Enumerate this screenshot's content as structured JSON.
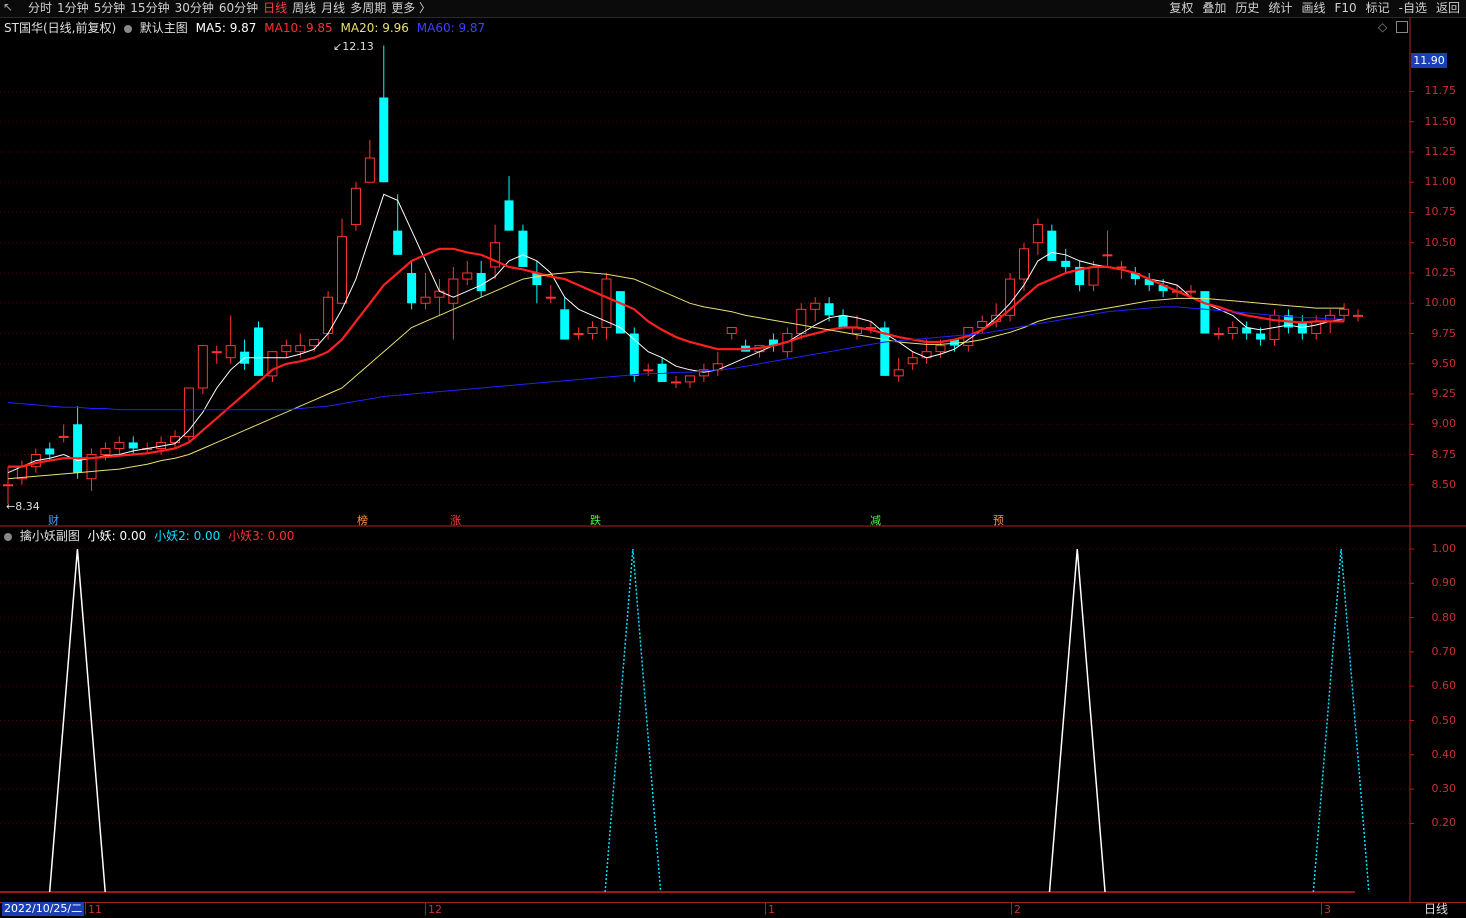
{
  "toolbar": {
    "periods": [
      "分时",
      "1分钟",
      "5分钟",
      "15分钟",
      "30分钟",
      "60分钟",
      "日线",
      "周线",
      "月线",
      "多周期",
      "更多 〉"
    ],
    "active_period": "日线",
    "right_buttons": [
      "复权",
      "叠加",
      "历史",
      "统计",
      "画线",
      "F10",
      "标记",
      "-自选",
      "返回"
    ]
  },
  "main_legend": {
    "title": "ST国华(日线,前复权)",
    "template": "默认主图",
    "ma5": "MA5: 9.87",
    "ma10": "MA10: 9.85",
    "ma20": "MA20: 9.96",
    "ma60": "MA60: 9.87"
  },
  "colors": {
    "up": "#ff3333",
    "down": "#00ffff",
    "ma5": "#ffffff",
    "ma10": "#ff2020",
    "ma20": "#e8e070",
    "ma60": "#2020ff",
    "grid": "#5a0000",
    "axis": "#b02020"
  },
  "price_axis": {
    "current_price_tag": "11.90",
    "labels": [
      "11.75",
      "11.50",
      "11.25",
      "11.00",
      "10.75",
      "10.50",
      "10.25",
      "10.00",
      "9.75",
      "9.50",
      "9.25",
      "9.00",
      "8.75",
      "8.50"
    ]
  },
  "annotations": {
    "high": "12.13",
    "low": "8.34",
    "markers": [
      {
        "text": "财",
        "color": "#4aa0ff"
      },
      {
        "text": "榜",
        "color": "#ff9040"
      },
      {
        "text": "涨",
        "color": "#ff4040"
      },
      {
        "text": "跌",
        "color": "#40ff40"
      },
      {
        "text": "减",
        "color": "#40ff40"
      },
      {
        "text": "预",
        "color": "#ff9040"
      }
    ]
  },
  "indicator_legend": {
    "title": "擒小妖副图",
    "s1": "小妖: 0.00",
    "s2": "小妖2: 0.00",
    "s3": "小妖3: 0.00"
  },
  "indicator_axis": {
    "labels": [
      "1.00",
      "0.90",
      "0.80",
      "0.70",
      "0.60",
      "0.50",
      "0.40",
      "0.30",
      "0.20"
    ]
  },
  "date_axis": {
    "first_date": "2022/10/25/二",
    "labels": [
      "11",
      "12",
      "1",
      "2",
      "3"
    ],
    "period_label": "日线"
  },
  "chart_data": [
    {
      "type": "candlestick",
      "title": "ST国华(日线,前复权)",
      "candles": [
        [
          8.5,
          8.65,
          8.34,
          8.5
        ],
        [
          8.55,
          8.7,
          8.5,
          8.65
        ],
        [
          8.65,
          8.8,
          8.6,
          8.75
        ],
        [
          8.8,
          8.85,
          8.7,
          8.75
        ],
        [
          8.9,
          9.0,
          8.85,
          8.9
        ],
        [
          9.0,
          9.15,
          8.55,
          8.6
        ],
        [
          8.55,
          8.8,
          8.45,
          8.75
        ],
        [
          8.75,
          8.85,
          8.7,
          8.8
        ],
        [
          8.8,
          8.9,
          8.75,
          8.85
        ],
        [
          8.85,
          8.9,
          8.75,
          8.8
        ],
        [
          8.8,
          8.85,
          8.75,
          8.8
        ],
        [
          8.8,
          8.9,
          8.75,
          8.85
        ],
        [
          8.85,
          8.95,
          8.8,
          8.9
        ],
        [
          8.9,
          9.3,
          8.85,
          9.3
        ],
        [
          9.3,
          9.65,
          9.25,
          9.65
        ],
        [
          9.6,
          9.65,
          9.5,
          9.6
        ],
        [
          9.55,
          9.9,
          9.5,
          9.65
        ],
        [
          9.6,
          9.7,
          9.45,
          9.5
        ],
        [
          9.8,
          9.85,
          9.4,
          9.4
        ],
        [
          9.4,
          9.6,
          9.35,
          9.6
        ],
        [
          9.6,
          9.7,
          9.55,
          9.65
        ],
        [
          9.6,
          9.75,
          9.55,
          9.65
        ],
        [
          9.65,
          9.7,
          9.6,
          9.7
        ],
        [
          9.75,
          10.1,
          9.7,
          10.05
        ],
        [
          10.0,
          10.7,
          10.0,
          10.55
        ],
        [
          10.65,
          11.0,
          10.6,
          10.95
        ],
        [
          11.0,
          11.35,
          11.2,
          11.2
        ],
        [
          11.7,
          12.13,
          11.0,
          11.0
        ],
        [
          10.6,
          10.9,
          10.4,
          10.4
        ],
        [
          10.25,
          10.35,
          9.95,
          10.0
        ],
        [
          10.0,
          10.25,
          9.95,
          10.05
        ],
        [
          10.05,
          10.2,
          9.9,
          10.1
        ],
        [
          10.0,
          10.3,
          9.7,
          10.2
        ],
        [
          10.2,
          10.35,
          10.15,
          10.25
        ],
        [
          10.25,
          10.35,
          10.05,
          10.1
        ],
        [
          10.3,
          10.65,
          10.2,
          10.5
        ],
        [
          10.85,
          11.05,
          10.6,
          10.6
        ],
        [
          10.6,
          10.65,
          10.3,
          10.3
        ],
        [
          10.25,
          10.35,
          10.0,
          10.15
        ],
        [
          10.05,
          10.15,
          10.0,
          10.05
        ],
        [
          9.95,
          10.05,
          9.7,
          9.7
        ],
        [
          9.75,
          9.8,
          9.7,
          9.75
        ],
        [
          9.75,
          9.85,
          9.7,
          9.8
        ],
        [
          9.8,
          10.25,
          9.7,
          10.2
        ],
        [
          10.1,
          10.1,
          9.75,
          9.75
        ],
        [
          9.75,
          9.8,
          9.35,
          9.4
        ],
        [
          9.45,
          9.5,
          9.4,
          9.45
        ],
        [
          9.5,
          9.55,
          9.35,
          9.35
        ],
        [
          9.35,
          9.4,
          9.3,
          9.35
        ],
        [
          9.35,
          9.4,
          9.3,
          9.4
        ],
        [
          9.4,
          9.5,
          9.35,
          9.45
        ],
        [
          9.45,
          9.6,
          9.4,
          9.5
        ],
        [
          9.75,
          9.8,
          9.7,
          9.8
        ],
        [
          9.65,
          9.7,
          9.6,
          9.6
        ],
        [
          9.6,
          9.65,
          9.55,
          9.65
        ],
        [
          9.7,
          9.75,
          9.6,
          9.65
        ],
        [
          9.6,
          9.8,
          9.55,
          9.75
        ],
        [
          9.75,
          10.0,
          9.7,
          9.95
        ],
        [
          9.95,
          10.05,
          9.85,
          10.0
        ],
        [
          10.0,
          10.05,
          9.85,
          9.9
        ],
        [
          9.9,
          9.95,
          9.8,
          9.8
        ],
        [
          9.75,
          9.9,
          9.7,
          9.8
        ],
        [
          9.8,
          9.85,
          9.75,
          9.8
        ],
        [
          9.8,
          9.85,
          9.4,
          9.4
        ],
        [
          9.4,
          9.55,
          9.35,
          9.45
        ],
        [
          9.5,
          9.6,
          9.45,
          9.55
        ],
        [
          9.55,
          9.7,
          9.5,
          9.6
        ],
        [
          9.6,
          9.7,
          9.55,
          9.65
        ],
        [
          9.7,
          9.7,
          9.6,
          9.65
        ],
        [
          9.65,
          9.8,
          9.6,
          9.8
        ],
        [
          9.8,
          9.9,
          9.75,
          9.85
        ],
        [
          9.85,
          10.0,
          9.8,
          9.9
        ],
        [
          9.9,
          10.25,
          9.85,
          10.2
        ],
        [
          10.2,
          10.5,
          10.1,
          10.45
        ],
        [
          10.5,
          10.7,
          10.4,
          10.65
        ],
        [
          10.6,
          10.65,
          10.35,
          10.35
        ],
        [
          10.35,
          10.45,
          10.25,
          10.3
        ],
        [
          10.3,
          10.35,
          10.1,
          10.15
        ],
        [
          10.15,
          10.35,
          10.1,
          10.3
        ],
        [
          10.4,
          10.6,
          10.3,
          10.4
        ],
        [
          10.3,
          10.35,
          10.2,
          10.3
        ],
        [
          10.25,
          10.3,
          10.15,
          10.2
        ],
        [
          10.2,
          10.25,
          10.1,
          10.15
        ],
        [
          10.15,
          10.2,
          10.05,
          10.1
        ],
        [
          10.1,
          10.15,
          10.05,
          10.1
        ],
        [
          10.1,
          10.15,
          10.05,
          10.1
        ],
        [
          10.1,
          10.1,
          9.75,
          9.75
        ],
        [
          9.75,
          9.8,
          9.7,
          9.75
        ],
        [
          9.75,
          9.85,
          9.7,
          9.8
        ],
        [
          9.8,
          9.85,
          9.7,
          9.75
        ],
        [
          9.75,
          9.8,
          9.65,
          9.7
        ],
        [
          9.7,
          9.95,
          9.65,
          9.9
        ],
        [
          9.9,
          9.95,
          9.75,
          9.8
        ],
        [
          9.85,
          9.9,
          9.7,
          9.75
        ],
        [
          9.75,
          9.9,
          9.7,
          9.85
        ],
        [
          9.85,
          9.95,
          9.75,
          9.9
        ],
        [
          9.9,
          10.0,
          9.85,
          9.95
        ],
        [
          9.9,
          9.95,
          9.85,
          9.9
        ]
      ],
      "ma_series": [
        {
          "name": "MA5",
          "values": [
            8.6,
            8.65,
            8.7,
            8.72,
            8.75,
            8.7,
            8.72,
            8.74,
            8.75,
            8.78,
            8.8,
            8.82,
            8.84,
            8.95,
            9.1,
            9.3,
            9.45,
            9.55,
            9.55,
            9.55,
            9.55,
            9.58,
            9.62,
            9.75,
            9.95,
            10.2,
            10.55,
            10.9,
            10.85,
            10.6,
            10.35,
            10.1,
            10.05,
            10.1,
            10.15,
            10.22,
            10.35,
            10.4,
            10.35,
            10.25,
            10.05,
            9.95,
            9.9,
            9.85,
            9.8,
            9.7,
            9.6,
            9.55,
            9.48,
            9.45,
            9.43,
            9.45,
            9.5,
            9.55,
            9.6,
            9.65,
            9.68,
            9.75,
            9.82,
            9.88,
            9.9,
            9.88,
            9.85,
            9.75,
            9.68,
            9.6,
            9.55,
            9.58,
            9.62,
            9.7,
            9.78,
            9.88,
            10.0,
            10.15,
            10.35,
            10.42,
            10.4,
            10.35,
            10.32,
            10.3,
            10.28,
            10.25,
            10.2,
            10.18,
            10.15,
            10.05,
            10.0,
            9.95,
            9.9,
            9.8,
            9.78,
            9.8,
            9.82,
            9.8,
            9.82,
            9.85,
            9.87
          ]
        },
        {
          "name": "MA10",
          "values": [
            8.65,
            8.65,
            8.68,
            8.7,
            8.72,
            8.72,
            8.72,
            8.73,
            8.74,
            8.75,
            8.76,
            8.78,
            8.8,
            8.85,
            8.95,
            9.05,
            9.15,
            9.25,
            9.35,
            9.45,
            9.5,
            9.52,
            9.55,
            9.6,
            9.7,
            9.85,
            10.0,
            10.15,
            10.25,
            10.35,
            10.4,
            10.45,
            10.45,
            10.42,
            10.4,
            10.35,
            10.3,
            10.28,
            10.25,
            10.22,
            10.2,
            10.15,
            10.1,
            10.05,
            10.0,
            9.95,
            9.85,
            9.78,
            9.72,
            9.68,
            9.65,
            9.62,
            9.62,
            9.62,
            9.63,
            9.65,
            9.68,
            9.72,
            9.75,
            9.78,
            9.8,
            9.8,
            9.78,
            9.75,
            9.72,
            9.7,
            9.68,
            9.68,
            9.7,
            9.73,
            9.78,
            9.85,
            9.95,
            10.05,
            10.15,
            10.2,
            10.25,
            10.28,
            10.3,
            10.3,
            10.28,
            10.25,
            10.2,
            10.15,
            10.1,
            10.05,
            10.0,
            9.97,
            9.93,
            9.9,
            9.88,
            9.86,
            9.85,
            9.84,
            9.85,
            9.85,
            9.85
          ]
        },
        {
          "name": "MA20",
          "values": [
            8.55,
            8.56,
            8.57,
            8.58,
            8.59,
            8.6,
            8.61,
            8.62,
            8.63,
            8.65,
            8.67,
            8.7,
            8.72,
            8.75,
            8.8,
            8.85,
            8.9,
            8.95,
            9.0,
            9.05,
            9.1,
            9.15,
            9.2,
            9.25,
            9.3,
            9.4,
            9.5,
            9.6,
            9.7,
            9.8,
            9.85,
            9.9,
            9.95,
            10.0,
            10.05,
            10.1,
            10.15,
            10.2,
            10.22,
            10.24,
            10.25,
            10.26,
            10.25,
            10.24,
            10.22,
            10.2,
            10.15,
            10.1,
            10.05,
            10.0,
            9.97,
            9.95,
            9.93,
            9.9,
            9.88,
            9.86,
            9.84,
            9.82,
            9.8,
            9.78,
            9.76,
            9.74,
            9.72,
            9.7,
            9.68,
            9.67,
            9.66,
            9.66,
            9.67,
            9.68,
            9.7,
            9.73,
            9.76,
            9.8,
            9.85,
            9.88,
            9.9,
            9.92,
            9.94,
            9.96,
            9.98,
            10.0,
            10.02,
            10.03,
            10.04,
            10.04,
            10.04,
            10.03,
            10.02,
            10.01,
            10.0,
            9.99,
            9.98,
            9.97,
            9.96,
            9.96,
            9.96
          ]
        },
        {
          "name": "MA60",
          "values": [
            9.18,
            9.17,
            9.16,
            9.15,
            9.14,
            9.14,
            9.13,
            9.13,
            9.12,
            9.12,
            9.12,
            9.12,
            9.12,
            9.12,
            9.12,
            9.12,
            9.12,
            9.12,
            9.12,
            9.12,
            9.12,
            9.13,
            9.14,
            9.15,
            9.17,
            9.19,
            9.21,
            9.23,
            9.24,
            9.25,
            9.26,
            9.27,
            9.28,
            9.29,
            9.3,
            9.31,
            9.32,
            9.33,
            9.34,
            9.35,
            9.36,
            9.37,
            9.38,
            9.39,
            9.4,
            9.41,
            9.42,
            9.42,
            9.43,
            9.43,
            9.44,
            9.45,
            9.46,
            9.48,
            9.5,
            9.52,
            9.54,
            9.56,
            9.58,
            9.6,
            9.62,
            9.64,
            9.66,
            9.68,
            9.69,
            9.7,
            9.71,
            9.72,
            9.73,
            9.74,
            9.75,
            9.77,
            9.79,
            9.81,
            9.83,
            9.85,
            9.87,
            9.89,
            9.91,
            9.93,
            9.94,
            9.95,
            9.96,
            9.97,
            9.97,
            9.96,
            9.95,
            9.94,
            9.93,
            9.92,
            9.91,
            9.9,
            9.89,
            9.88,
            9.88,
            9.87,
            9.87
          ]
        }
      ],
      "ylim": [
        8.3,
        12.2
      ]
    },
    {
      "type": "line",
      "title": "擒小妖副图",
      "series": [
        {
          "name": "小妖",
          "peaks": [
            {
              "start": 3,
              "peak": 5,
              "end": 7
            },
            {
              "start": 75,
              "peak": 77,
              "end": 79
            }
          ]
        },
        {
          "name": "小妖2",
          "peaks": [
            {
              "start": 43,
              "peak": 45,
              "end": 47
            },
            {
              "start": 94,
              "peak": 96,
              "end": 98
            }
          ]
        },
        {
          "name": "小妖3",
          "peaks": []
        }
      ],
      "ylim": [
        0,
        1.0
      ]
    }
  ]
}
